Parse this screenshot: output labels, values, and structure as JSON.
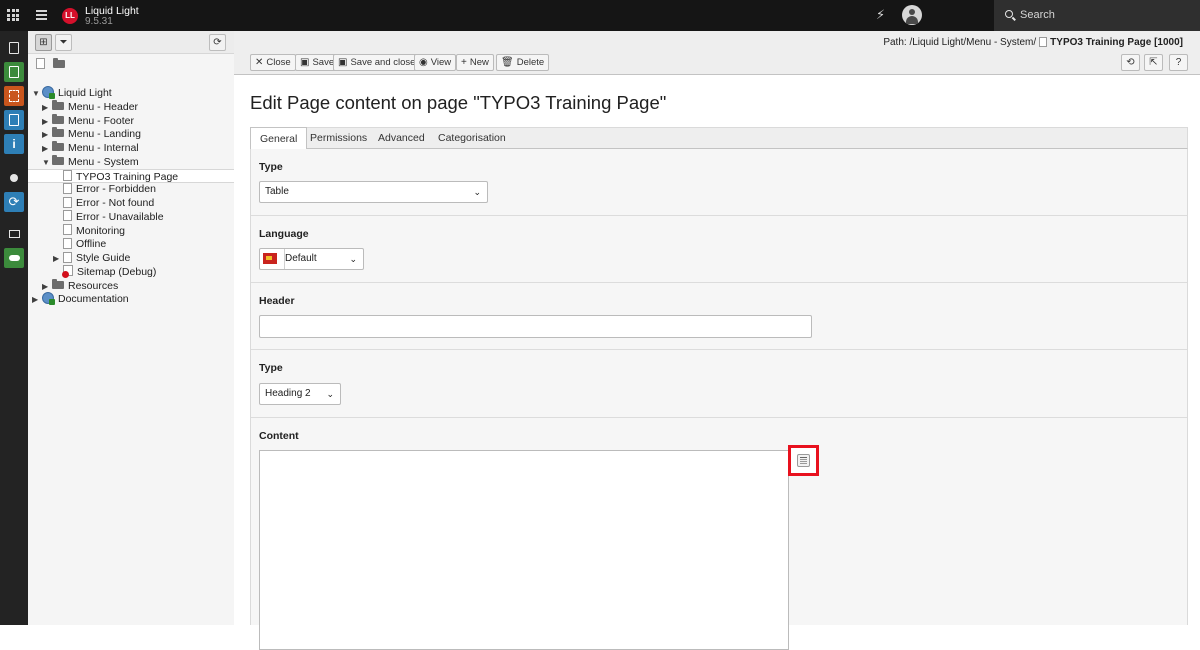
{
  "topbar": {
    "site_name": "Liquid Light",
    "version": "9.5.31",
    "logo_text": "LL",
    "search_label": "Search"
  },
  "modules": [
    "page-module",
    "view-module",
    "list-module",
    "form-module",
    "info-module",
    "sites-module",
    "refresh-module",
    "filelist-module",
    "cloud-module"
  ],
  "tree": {
    "nodes": [
      {
        "label": "Liquid Light",
        "icon": "globe",
        "arrow": "▼",
        "level": 0
      },
      {
        "label": "Menu - Header",
        "icon": "folder",
        "arrow": "▶",
        "level": 1
      },
      {
        "label": "Menu - Footer",
        "icon": "folder",
        "arrow": "▶",
        "level": 1
      },
      {
        "label": "Menu - Landing",
        "icon": "folder",
        "arrow": "▶",
        "level": 1
      },
      {
        "label": "Menu - Internal",
        "icon": "folder",
        "arrow": "▶",
        "level": 1
      },
      {
        "label": "Menu - System",
        "icon": "folder",
        "arrow": "▼",
        "level": 1
      },
      {
        "label": "TYPO3 Training Page",
        "icon": "page",
        "arrow": "",
        "level": 2,
        "selected": true
      },
      {
        "label": "Error - Forbidden",
        "icon": "page",
        "arrow": "",
        "level": 2
      },
      {
        "label": "Error - Not found",
        "icon": "page",
        "arrow": "",
        "level": 2
      },
      {
        "label": "Error - Unavailable",
        "icon": "page",
        "arrow": "",
        "level": 2
      },
      {
        "label": "Monitoring",
        "icon": "page",
        "arrow": "",
        "level": 2
      },
      {
        "label": "Offline",
        "icon": "page",
        "arrow": "",
        "level": 2
      },
      {
        "label": "Style Guide",
        "icon": "page",
        "arrow": "▶",
        "level": 2
      },
      {
        "label": "Sitemap (Debug)",
        "icon": "sitemap",
        "arrow": "",
        "level": 2
      },
      {
        "label": "Resources",
        "icon": "folder",
        "arrow": "▶",
        "level": 1
      },
      {
        "label": "Documentation",
        "icon": "globe",
        "arrow": "▶",
        "level": 0
      }
    ]
  },
  "docheader": {
    "path_prefix": "Path: /Liquid Light/Menu - System/",
    "path_page": "TYPO3 Training Page [1000]",
    "buttons": {
      "close": "Close",
      "save": "Save",
      "save_close": "Save and close",
      "view": "View",
      "new": "New",
      "delete": "Delete"
    }
  },
  "main": {
    "title": "Edit Page content on page \"TYPO3 Training Page\"",
    "tabs": [
      "General",
      "Permissions",
      "Advanced",
      "Categorisation"
    ],
    "active_tab": "General",
    "fields": {
      "ctype_label": "Type",
      "ctype_value": "Table",
      "language_label": "Language",
      "language_value": "Default",
      "header_label": "Header",
      "header_value": "",
      "header_type_label": "Type",
      "header_type_value": "Heading 2",
      "content_label": "Content",
      "content_value": ""
    }
  }
}
